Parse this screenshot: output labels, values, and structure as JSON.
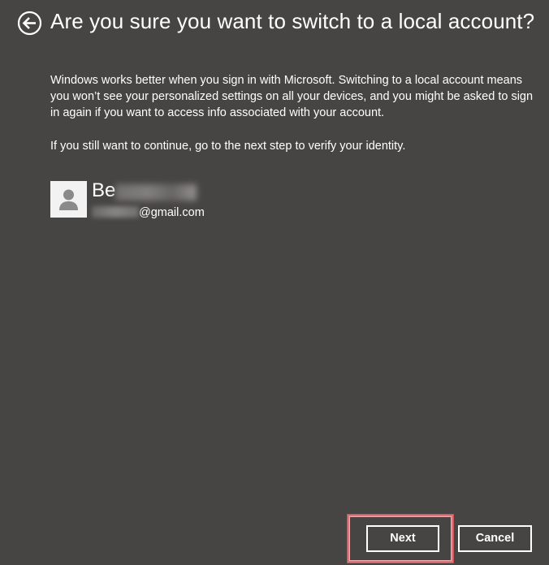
{
  "colors": {
    "background": "#474543",
    "text": "#ffffff",
    "avatar_bg": "#f2f2f2",
    "avatar_glyph": "#8a8a8a",
    "highlight": "#e0757c"
  },
  "icons": {
    "back": "back-arrow-circle-icon",
    "avatar": "user-silhouette-icon"
  },
  "header": {
    "title": "Are you sure you want to switch to a local account?"
  },
  "content": {
    "paragraph_1": "Windows works better when you sign in with Microsoft. Switching to a local account means you won’t see your personalized settings on all your devices, and you might be asked to sign in again if you want to access info associated with your account.",
    "paragraph_2": "If you still want to continue, go to the next step to verify your identity."
  },
  "account": {
    "name_visible": "Be",
    "email_visible": "@gmail.com"
  },
  "buttons": {
    "next_label": "Next",
    "cancel_label": "Cancel"
  }
}
